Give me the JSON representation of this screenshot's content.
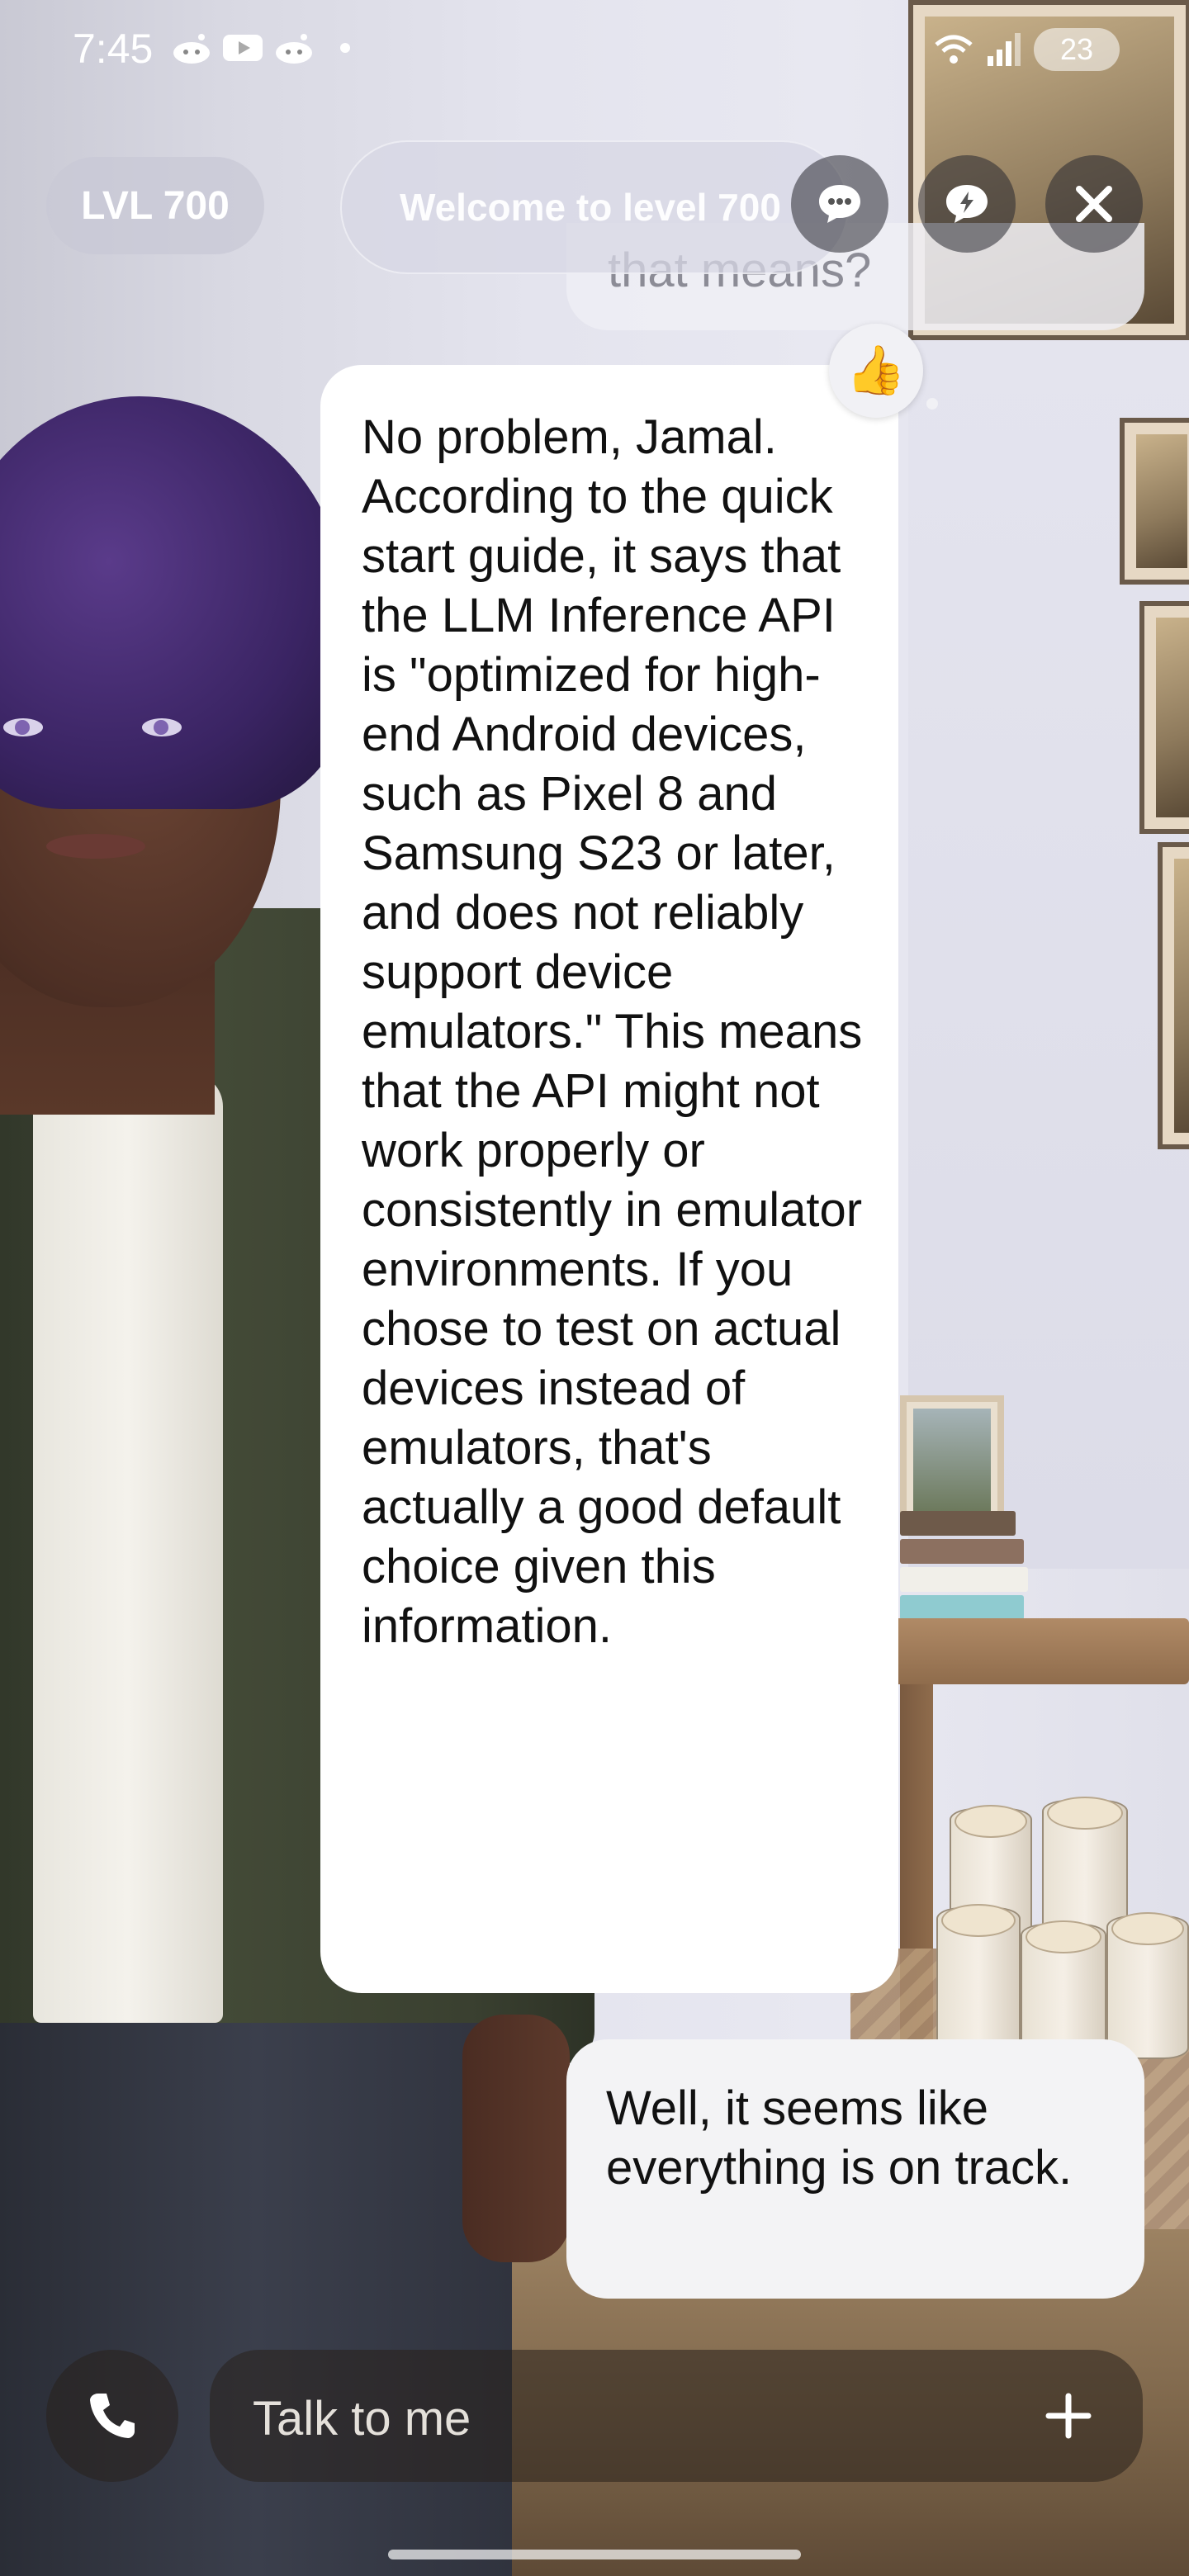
{
  "status_bar": {
    "time": "7:45",
    "battery": "23",
    "icons": [
      "reddit-icon",
      "youtube-icon",
      "reddit-icon",
      "notification-dot",
      "wifi-icon",
      "signal-icon",
      "battery-icon"
    ]
  },
  "top_bar": {
    "level_label": "LVL 700",
    "welcome_text": "Welcome to level 700",
    "buttons": [
      "chat-bubble-button",
      "feedback-button",
      "close-button"
    ]
  },
  "chat": {
    "previous_message_fragment": "that means?",
    "reaction": "👍",
    "ai_message": "No problem, Jamal. According to the quick start guide, it says that the LLM Inference API is \"optimized for high-end Android devices, such as Pixel 8 and Samsung S23 or later, and does not reliably support device emulators.\" This means that the API might not work properly or consistently in emulator environments. If you chose to test on actual devices instead of emulators, that's actually a good default choice given this information.",
    "user_message": "Well, it seems like everything is on track."
  },
  "input": {
    "placeholder": "Talk to me"
  },
  "colors": {
    "bubble_ai": "#ffffff",
    "bubble_user": "#f3f3f5",
    "control_dark": "#28201c"
  }
}
